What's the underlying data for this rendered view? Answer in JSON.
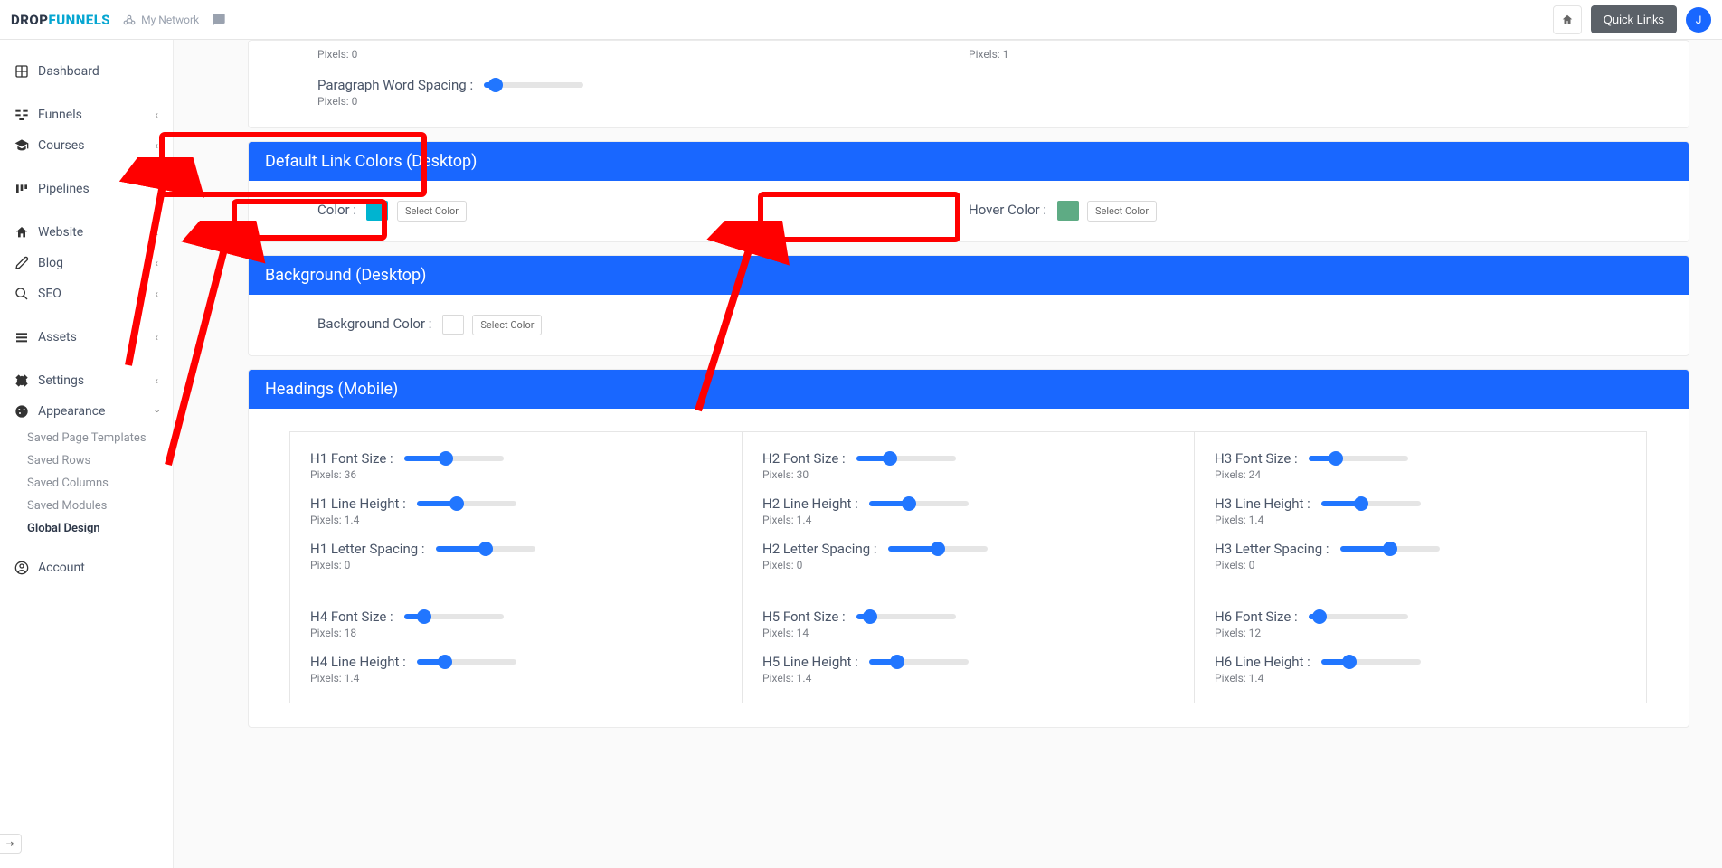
{
  "topbar": {
    "logo_a": "DROP",
    "logo_b": "FUNNELS",
    "my_network": "My Network",
    "quick_links": "Quick Links",
    "avatar_initial": "J"
  },
  "sidebar": {
    "dashboard": "Dashboard",
    "funnels": "Funnels",
    "courses": "Courses",
    "pipelines": "Pipelines",
    "website": "Website",
    "blog": "Blog",
    "seo": "SEO",
    "assets": "Assets",
    "settings": "Settings",
    "appearance": "Appearance",
    "account": "Account",
    "sub": {
      "spt": "Saved Page Templates",
      "sr": "Saved Rows",
      "sc": "Saved Columns",
      "sm": "Saved Modules",
      "gd": "Global Design"
    }
  },
  "top_slice": {
    "left_px": "Pixels: 0",
    "right_px": "Pixels: 1",
    "pws_label": "Paragraph Word Spacing :",
    "pws_px": "Pixels: 0"
  },
  "link_colors": {
    "title": "Default Link Colors (Desktop)",
    "color_label": "Color :",
    "color_swatch": "#00b4d0",
    "hover_label": "Hover Color :",
    "hover_swatch": "#5eab84",
    "select_btn": "Select Color"
  },
  "background": {
    "title": "Background (Desktop)",
    "label": "Background Color :",
    "select_btn": "Select Color"
  },
  "headings": {
    "title": "Headings (Mobile)",
    "cells": [
      {
        "fs_l": "H1 Font Size :",
        "fs_px": "Pixels: 36",
        "fs_p": 42,
        "lh_l": "H1 Line Height :",
        "lh_px": "Pixels: 1.4",
        "lh_p": 40,
        "ls_l": "H1 Letter Spacing :",
        "ls_px": "Pixels: 0",
        "ls_p": 50
      },
      {
        "fs_l": "H2 Font Size :",
        "fs_px": "Pixels: 30",
        "fs_p": 34,
        "lh_l": "H2 Line Height :",
        "lh_px": "Pixels: 1.4",
        "lh_p": 40,
        "ls_l": "H2 Letter Spacing :",
        "ls_px": "Pixels: 0",
        "ls_p": 50
      },
      {
        "fs_l": "H3 Font Size :",
        "fs_px": "Pixels: 24",
        "fs_p": 28,
        "lh_l": "H3 Line Height :",
        "lh_px": "Pixels: 1.4",
        "lh_p": 40,
        "ls_l": "H3 Letter Spacing :",
        "ls_px": "Pixels: 0",
        "ls_p": 50
      },
      {
        "fs_l": "H4 Font Size :",
        "fs_px": "Pixels: 18",
        "fs_p": 20,
        "lh_l": "H4 Line Height :",
        "lh_px": "Pixels: 1.4",
        "lh_p": 28
      },
      {
        "fs_l": "H5 Font Size :",
        "fs_px": "Pixels: 14",
        "fs_p": 14,
        "lh_l": "H5 Line Height :",
        "lh_px": "Pixels: 1.4",
        "lh_p": 28
      },
      {
        "fs_l": "H6 Font Size :",
        "fs_px": "Pixels: 12",
        "fs_p": 11,
        "lh_l": "H6 Line Height :",
        "lh_px": "Pixels: 1.4",
        "lh_p": 28
      }
    ]
  }
}
